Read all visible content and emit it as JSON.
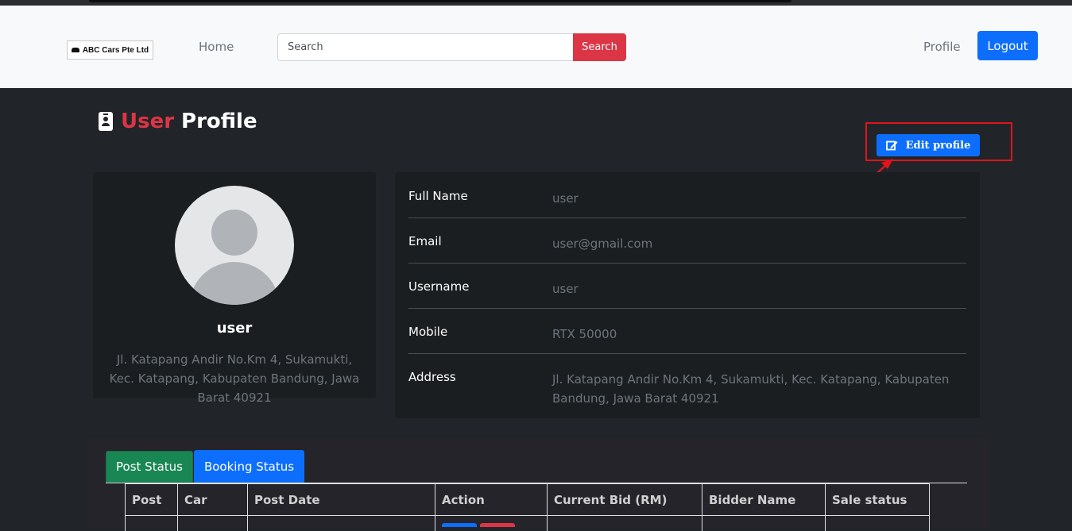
{
  "navbar": {
    "logo_text": "ABC Cars Pte Ltd",
    "home_label": "Home",
    "search_placeholder": "Search",
    "search_button": "Search",
    "profile_label": "Profile",
    "logout_label": "Logout"
  },
  "page": {
    "title_accent": "User",
    "title_rest": "Profile",
    "edit_button": "Edit profile"
  },
  "profile_card": {
    "name": "user",
    "address": "Jl. Katapang Andir No.Km 4, Sukamukti, Kec. Katapang, Kabupaten Bandung, Jawa Barat 40921"
  },
  "details": {
    "full_name_label": "Full Name",
    "full_name_value": "user",
    "email_label": "Email",
    "email_value": "user@gmail.com",
    "username_label": "Username",
    "username_value": "user",
    "mobile_label": "Mobile",
    "mobile_value": "RTX 50000",
    "address_label": "Address",
    "address_value": "Jl. Katapang Andir No.Km 4, Sukamukti, Kec. Katapang, Kabupaten Bandung, Jawa Barat 40921"
  },
  "tabs": {
    "post_status": "Post Status",
    "booking_status": "Booking Status"
  },
  "table": {
    "headers": [
      "Post",
      "Car",
      "Post Date",
      "Action",
      "Current Bid (RM)",
      "Bidder Name",
      "Sale status"
    ]
  },
  "colors": {
    "accent_red": "#dc3545",
    "primary_blue": "#0d6efd",
    "success_green": "#198754",
    "annotation_red": "#e0141a"
  }
}
